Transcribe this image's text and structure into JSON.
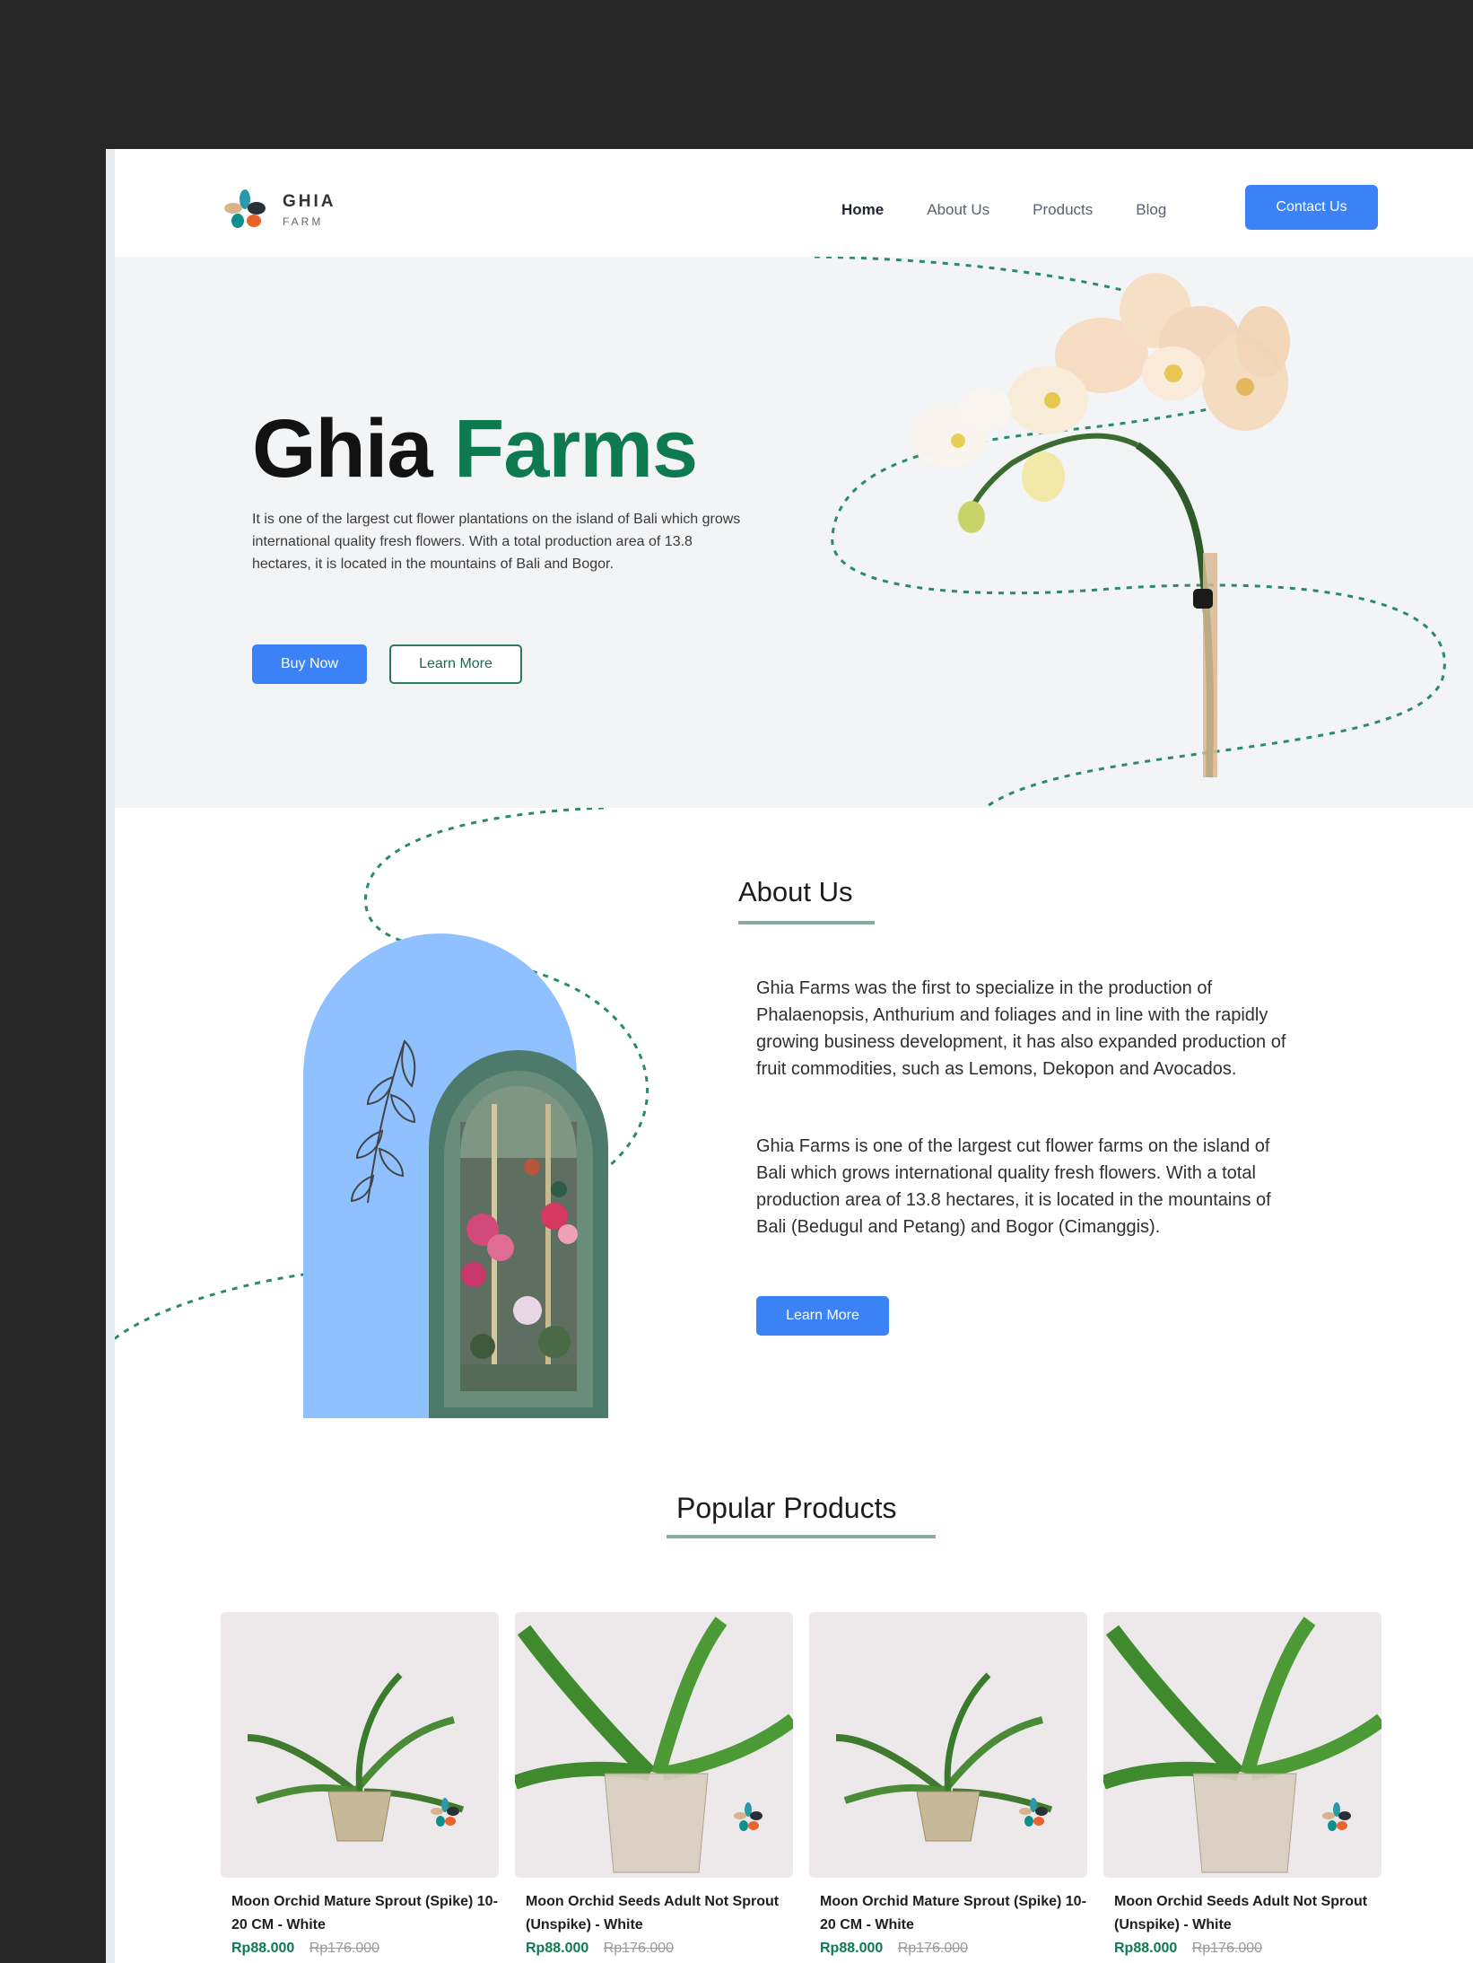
{
  "brand": {
    "name": "GHIA",
    "sub": "FARM"
  },
  "nav": {
    "links": [
      "Home",
      "About Us",
      "Products",
      "Blog"
    ],
    "contact_label": "Contact Us"
  },
  "hero": {
    "title_part1": "Ghia",
    "title_part2": "Farms",
    "text": "It is one of the largest cut flower plantations on the island of Bali which grows international quality fresh flowers. With a total production area of 13.8 hectares, it is located in the mountains of Bali and Bogor.",
    "buy_label": "Buy Now",
    "learn_label": "Learn More"
  },
  "about": {
    "title": "About Us",
    "p1": "Ghia Farms was the first to specialize in the production of Phalaenopsis, Anthurium and foliages and in line with the rapidly growing business development, it has also expanded production of fruit commodities, such as Lemons, Dekopon and Avocados.",
    "p2": "Ghia Farms is one of the largest cut flower farms on the island of Bali which grows international quality fresh flowers. With a total production area of 13.8 hectares, it is located in the mountains of Bali (Bedugul and Petang) and Bogor (Cimanggis).",
    "learn_label": "Learn More"
  },
  "popular": {
    "title": "Popular Products",
    "products": [
      {
        "name": "Moon Orchid Mature Sprout (Spike) 10-20 CM - White",
        "price": "Rp88.000",
        "old_price": "Rp176.000"
      },
      {
        "name": "Moon Orchid Seeds Adult Not Sprout (Unspike) - White",
        "price": "Rp88.000",
        "old_price": "Rp176.000"
      },
      {
        "name": "Moon Orchid Mature Sprout (Spike) 10-20 CM - White",
        "price": "Rp88.000",
        "old_price": "Rp176.000"
      },
      {
        "name": "Moon Orchid Seeds Adult Not Sprout (Unspike) - White",
        "price": "Rp88.000",
        "old_price": "Rp176.000"
      }
    ]
  },
  "colors": {
    "accent": "#3b82f6",
    "brand_green": "#0e7a51",
    "hero_bg": "#f3f4f6"
  }
}
